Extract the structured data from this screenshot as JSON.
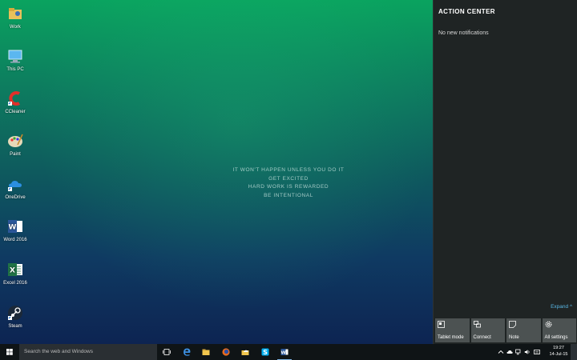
{
  "desktop_icons": [
    {
      "label": "Work",
      "icon": "folder-icon"
    },
    {
      "label": "This PC",
      "icon": "computer-icon"
    },
    {
      "label": "CCleaner",
      "icon": "ccleaner-icon"
    },
    {
      "label": "Paint",
      "icon": "paint-icon"
    },
    {
      "label": "OneDrive",
      "icon": "onedrive-icon"
    },
    {
      "label": "Word 2016",
      "icon": "word-icon"
    },
    {
      "label": "Excel 2016",
      "icon": "excel-icon"
    },
    {
      "label": "Steam",
      "icon": "steam-icon"
    }
  ],
  "wallpaper_quote": [
    "IT WON'T HAPPEN UNLESS YOU DO IT",
    "GET EXCITED",
    "HARD WORK IS REWARDED",
    "BE INTENTIONAL"
  ],
  "action_center": {
    "title": "ACTION CENTER",
    "empty_message": "No new notifications",
    "expand_label": "Expand ^",
    "tiles": [
      {
        "label": "Tablet mode",
        "icon": "tablet-mode-icon"
      },
      {
        "label": "Connect",
        "icon": "connect-icon"
      },
      {
        "label": "Note",
        "icon": "note-icon"
      },
      {
        "label": "All settings",
        "icon": "settings-icon"
      }
    ]
  },
  "taskbar": {
    "search_placeholder": "Search the web and Windows",
    "apps": [
      "task-view-icon",
      "edge-icon",
      "file-explorer-icon",
      "firefox-icon",
      "onedrive-folder-icon",
      "skype-icon",
      "word-icon"
    ],
    "clock_time": "19:27",
    "clock_date": "14-Jul-15"
  },
  "colors": {
    "accent": "#59b8e6",
    "action_center_bg": "#1f2424",
    "tile_bg": "#4c5252",
    "taskbar_bg": "#0f1416"
  }
}
